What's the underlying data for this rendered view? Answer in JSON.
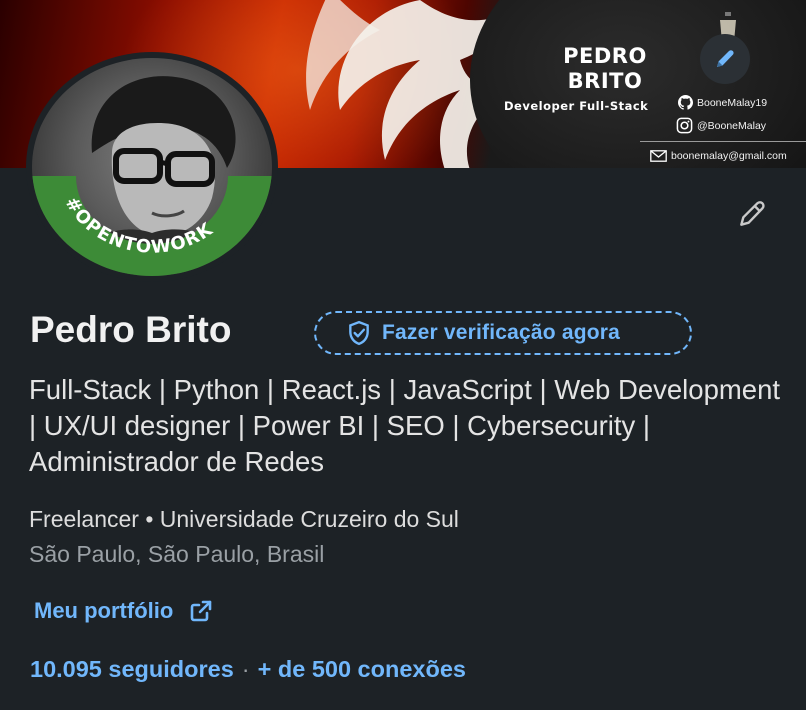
{
  "banner": {
    "name_line1": "PEDRO",
    "name_line2": "BRITO",
    "role": "Developer Full-Stack",
    "github": "BooneMalay19",
    "instagram": "@BooneMalay",
    "email": "boonemalay@gmail.com"
  },
  "avatar": {
    "frame_text": "#OPENTOWORK",
    "frame_color": "#3d8b37"
  },
  "profile": {
    "name": "Pedro Brito",
    "verify_label": "Fazer verificação agora",
    "headline": "Full-Stack | Python | React.js | JavaScript | Web Development | UX/UI designer | Power BI | SEO | Cybersecurity | Administrador de Redes",
    "workplace": "Freelancer • Universidade Cruzeiro do Sul",
    "location": "São Paulo, São Paulo, Brasil",
    "portfolio_label": "Meu portfólio",
    "followers": "10.095 seguidores",
    "separator": "·",
    "connections": "+ de 500 conexões"
  },
  "colors": {
    "background": "#1d2226",
    "link": "#71b7fb",
    "text": "#e9e9e9",
    "muted": "#9aa0a5"
  },
  "icons": [
    "pencil-icon",
    "shield-check-icon",
    "external-link-icon",
    "github-icon",
    "instagram-icon",
    "mail-icon"
  ]
}
